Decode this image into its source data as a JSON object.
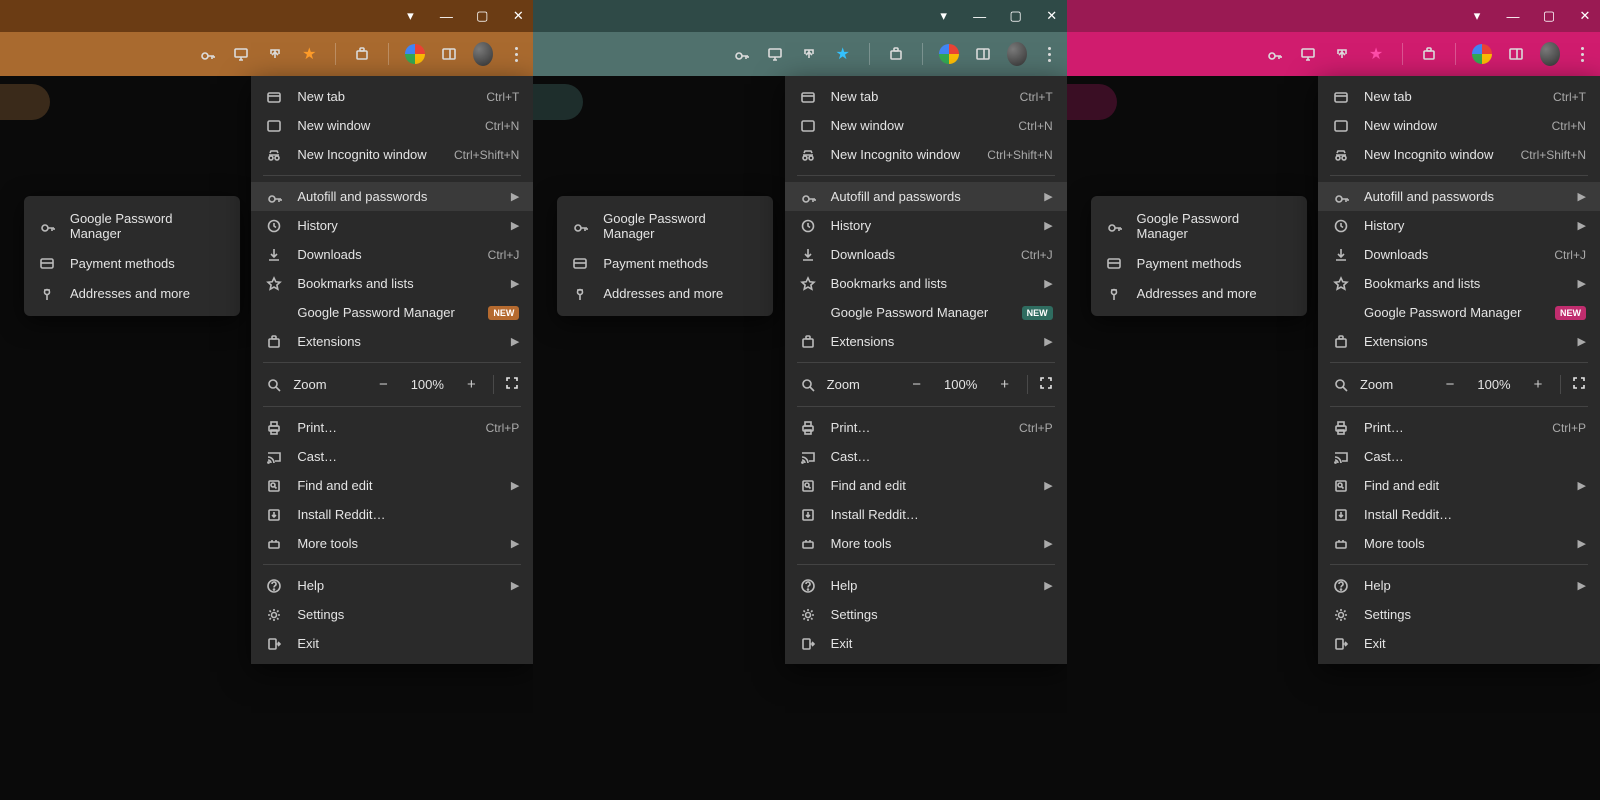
{
  "panes": [
    0,
    1,
    2
  ],
  "win": {
    "dropdown": "▾",
    "min": "—",
    "max": "▢",
    "close": "✕"
  },
  "toolbar_icons": [
    "key",
    "screen",
    "share",
    "star",
    "ext",
    "google",
    "panel",
    "avatar",
    "kebab"
  ],
  "actrow_icons": [
    "compass",
    "circles",
    "chat",
    "bell"
  ],
  "submenu": {
    "items": [
      {
        "icon": "key",
        "label": "Google Password Manager"
      },
      {
        "icon": "card",
        "label": "Payment methods"
      },
      {
        "icon": "pin",
        "label": "Addresses and more"
      }
    ]
  },
  "menu": [
    {
      "t": "item",
      "icon": "tab",
      "label": "New tab",
      "shortcut": "Ctrl+T"
    },
    {
      "t": "item",
      "icon": "win",
      "label": "New window",
      "shortcut": "Ctrl+N"
    },
    {
      "t": "item",
      "icon": "incog",
      "label": "New Incognito window",
      "shortcut": "Ctrl+Shift+N"
    },
    {
      "t": "sep"
    },
    {
      "t": "item",
      "icon": "key",
      "label": "Autofill and passwords",
      "chev": true,
      "hov": true
    },
    {
      "t": "item",
      "icon": "hist",
      "label": "History",
      "chev": true
    },
    {
      "t": "item",
      "icon": "dl",
      "label": "Downloads",
      "shortcut": "Ctrl+J"
    },
    {
      "t": "item",
      "icon": "bm",
      "label": "Bookmarks and lists",
      "chev": true
    },
    {
      "t": "item",
      "icon": "",
      "label": "Google Password Manager",
      "badge": "NEW"
    },
    {
      "t": "item",
      "icon": "ext",
      "label": "Extensions",
      "chev": true
    },
    {
      "t": "sep"
    },
    {
      "t": "zoom",
      "icon": "zoom",
      "label": "Zoom",
      "value": "100%"
    },
    {
      "t": "sep"
    },
    {
      "t": "item",
      "icon": "print",
      "label": "Print…",
      "shortcut": "Ctrl+P"
    },
    {
      "t": "item",
      "icon": "cast",
      "label": "Cast…"
    },
    {
      "t": "item",
      "icon": "find",
      "label": "Find and edit",
      "chev": true
    },
    {
      "t": "item",
      "icon": "install",
      "label": "Install Reddit…"
    },
    {
      "t": "item",
      "icon": "tools",
      "label": "More tools",
      "chev": true
    },
    {
      "t": "sep"
    },
    {
      "t": "item",
      "icon": "help",
      "label": "Help",
      "chev": true
    },
    {
      "t": "item",
      "icon": "gear",
      "label": "Settings"
    },
    {
      "t": "item",
      "icon": "exit",
      "label": "Exit"
    }
  ]
}
